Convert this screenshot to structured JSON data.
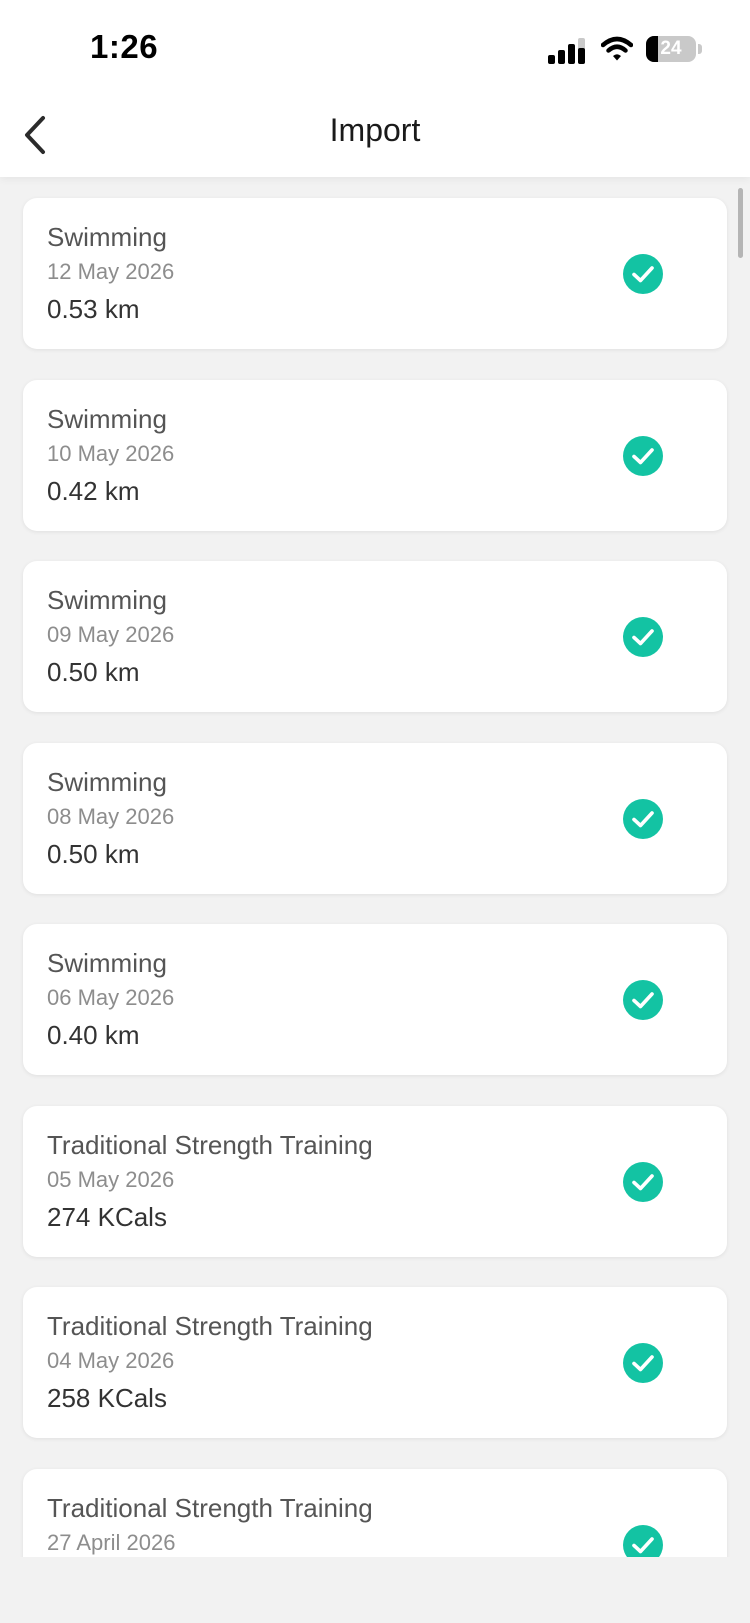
{
  "status_bar": {
    "time": "1:26",
    "battery_level": "24",
    "battery_fraction": 0.24
  },
  "nav": {
    "title": "Import",
    "back_icon": "chevron-left-icon"
  },
  "colors": {
    "accent": "#13c3a3",
    "background": "#f2f2f2",
    "card": "#ffffff"
  },
  "items": [
    {
      "title": "Swimming",
      "date": "12 May 2026",
      "value": "0.53 km",
      "checked": true
    },
    {
      "title": "Swimming",
      "date": "10 May 2026",
      "value": "0.42 km",
      "checked": true
    },
    {
      "title": "Swimming",
      "date": "09 May 2026",
      "value": "0.50 km",
      "checked": true
    },
    {
      "title": "Swimming",
      "date": "08 May 2026",
      "value": "0.50 km",
      "checked": true
    },
    {
      "title": "Swimming",
      "date": "06 May 2026",
      "value": "0.40 km",
      "checked": true
    },
    {
      "title": "Traditional Strength Training",
      "date": "05 May 2026",
      "value": "274 KCals",
      "checked": true
    },
    {
      "title": "Traditional Strength Training",
      "date": "04 May 2026",
      "value": "258 KCals",
      "checked": true
    },
    {
      "title": "Traditional Strength Training",
      "date": "27 April 2026",
      "value": "",
      "checked": true
    }
  ]
}
